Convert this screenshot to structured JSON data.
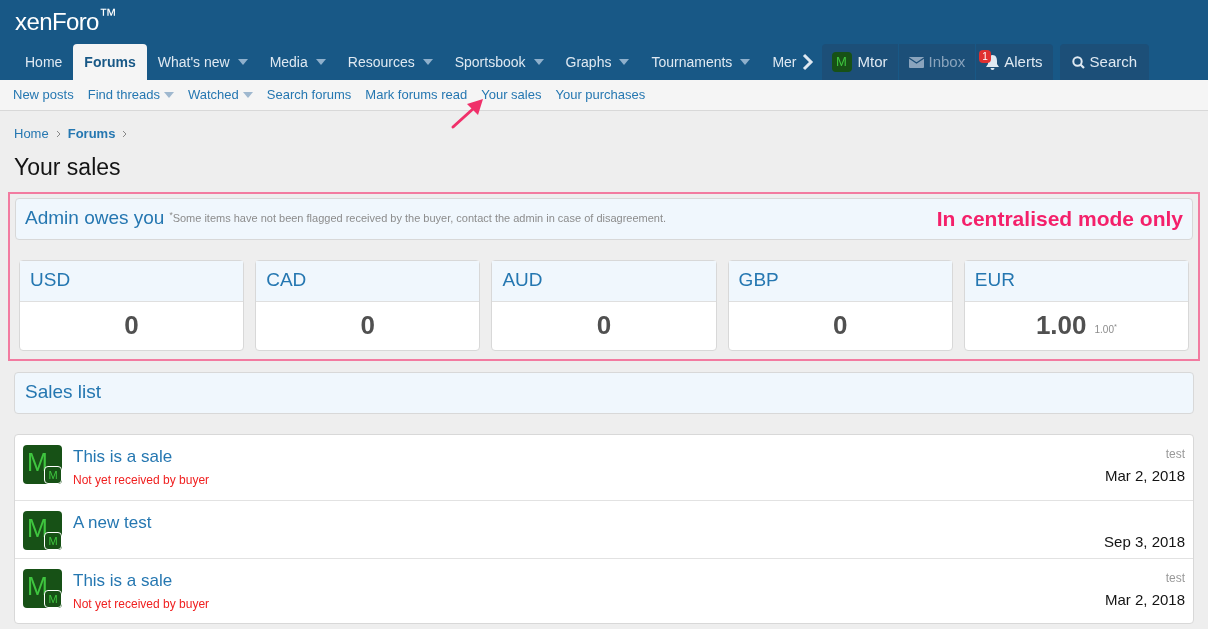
{
  "logo": "xenForo$^{™}$",
  "nav": {
    "tabs": [
      {
        "label": "Home",
        "selected": false,
        "dropdown": false
      },
      {
        "label": "Forums",
        "selected": true,
        "dropdown": false
      },
      {
        "label": "What's new",
        "selected": false,
        "dropdown": true
      },
      {
        "label": "Media",
        "selected": false,
        "dropdown": true
      },
      {
        "label": "Resources",
        "selected": false,
        "dropdown": true
      },
      {
        "label": "Sportsbook",
        "selected": false,
        "dropdown": true
      },
      {
        "label": "Graphs",
        "selected": false,
        "dropdown": true
      },
      {
        "label": "Tournaments",
        "selected": false,
        "dropdown": true
      },
      {
        "label": "Mer",
        "selected": false,
        "dropdown": false
      }
    ],
    "account": {
      "avatar": "M",
      "name": "Mtor"
    },
    "inbox": {
      "label": "Inbox",
      "disabled": true
    },
    "alerts": {
      "label": "Alerts",
      "badge": "1"
    },
    "search": {
      "label": "Search"
    }
  },
  "subnav": [
    {
      "label": "New posts",
      "dropdown": false
    },
    {
      "label": "Find threads",
      "dropdown": true
    },
    {
      "label": "Watched",
      "dropdown": true
    },
    {
      "label": "Search forums",
      "dropdown": false
    },
    {
      "label": "Mark forums read",
      "dropdown": false
    },
    {
      "label": "Your sales",
      "dropdown": false
    },
    {
      "label": "Your purchases",
      "dropdown": false
    }
  ],
  "breadcrumbs": [
    {
      "label": "Home",
      "current": false
    },
    {
      "label": "Forums",
      "current": true
    }
  ],
  "title": "Your sales",
  "owes": {
    "title": "Admin owes you",
    "note": "$^{*}$Some items have not been flagged received by the buyer, contact the admin in case of disagreement.",
    "annotation": "In centralised mode only",
    "currencies": [
      {
        "code": "USD",
        "amount": "0"
      },
      {
        "code": "CAD",
        "amount": "0"
      },
      {
        "code": "AUD",
        "amount": "0"
      },
      {
        "code": "GBP",
        "amount": "0"
      },
      {
        "code": "EUR",
        "amount": "1.00",
        "pending": "1.00$^{*}$"
      }
    ]
  },
  "sales": {
    "title": "Sales list",
    "rows": [
      {
        "avatar": "M",
        "mini_avatar": "M",
        "title": "This is a sale",
        "status": "Not yet received by buyer",
        "author": "test",
        "date": "Mar 2, 2018"
      },
      {
        "avatar": "M",
        "mini_avatar": "M",
        "title": "A new test",
        "date": "Sep 3, 2018"
      },
      {
        "avatar": "M",
        "mini_avatar": "M",
        "title": "This is a sale",
        "status": "Not yet received by buyer",
        "author": "test",
        "date": "Mar 2, 2018"
      }
    ]
  }
}
